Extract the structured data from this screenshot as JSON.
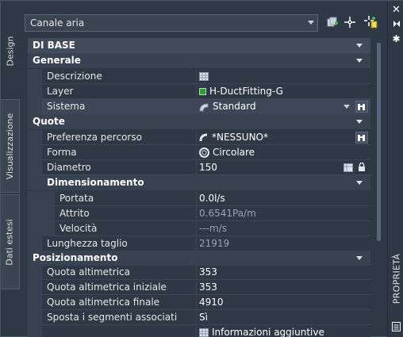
{
  "palette": {
    "title": "PROPRIETÀ",
    "tabs": [
      {
        "label": "Design"
      },
      {
        "label": "Visualizzazione"
      },
      {
        "label": "Dati estesi"
      }
    ]
  },
  "object_combo": {
    "value": "Canale aria"
  },
  "icons": {
    "close": "close-icon",
    "autohide": "autohide-icon",
    "options": "gear-icon",
    "quick_select": "quick-select-icon",
    "select_objects": "select-objects-icon",
    "toggle_pickadd": "pickadd-icon"
  },
  "sections": {
    "di_base": "DI BASE",
    "generale": "Generale",
    "quote": "Quote",
    "dimensionamento": "Dimensionamento",
    "posizionamento": "Posizionamento"
  },
  "rows": {
    "descrizione": {
      "name": "Descrizione",
      "value": ""
    },
    "layer": {
      "name": "Layer",
      "value": "H-DuctFitting-G",
      "swatch": "#2e9e2e"
    },
    "sistema": {
      "name": "Sistema",
      "value": "Standard"
    },
    "preferenza": {
      "name": "Preferenza percorso",
      "value": "*NESSUNO*"
    },
    "forma": {
      "name": "Forma",
      "value": "Circolare"
    },
    "diametro": {
      "name": "Diametro",
      "value": "150"
    },
    "portata": {
      "name": "Portata",
      "value": "0.0l/s"
    },
    "attrito": {
      "name": "Attrito",
      "value": "0.6541Pa/m"
    },
    "velocita": {
      "name": "Velocità",
      "value": "---m/s"
    },
    "lunghezza": {
      "name": "Lunghezza taglio",
      "value": "21919"
    },
    "quota_alt": {
      "name": "Quota altimetrica",
      "value": "353"
    },
    "quota_iniz": {
      "name": "Quota altimetrica iniziale",
      "value": "353"
    },
    "quota_fin": {
      "name": "Quota altimetrica finale",
      "value": "4910"
    },
    "sposta": {
      "name": "Sposta i segmenti associati",
      "value": "Sì"
    },
    "info": {
      "name": "",
      "value": "Informazioni aggiuntive"
    }
  }
}
